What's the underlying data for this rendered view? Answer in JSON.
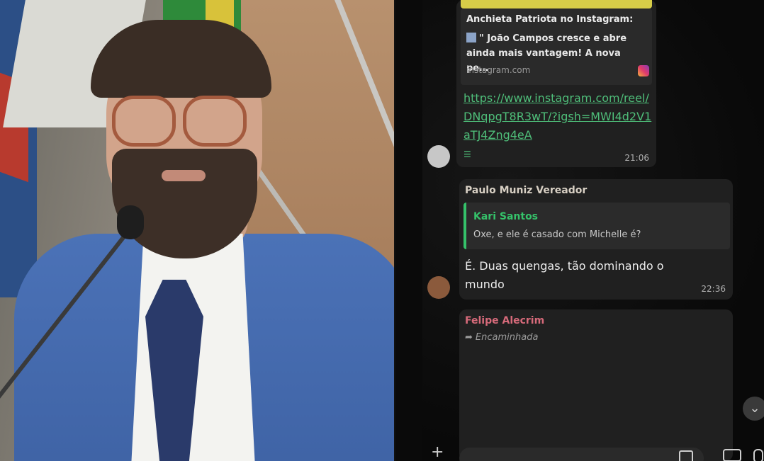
{
  "chat": {
    "message1": {
      "preview_title": "Anchieta Patriota no Instagram:",
      "preview_text": "\" João Campos cresce e abre ainda mais vantagem! A nova pe…",
      "preview_domain": "instagram.com",
      "link": "https://www.instagram.com/reel/DNqpgT8R3wT/?igsh=MWI4d2V1aTJ4Zng4eA",
      "time": "21:06"
    },
    "message2": {
      "sender": "Paulo Muniz Vereador",
      "quoted_name": "Kari Santos",
      "quoted_text": "Oxe, e ele é casado com Michelle é?",
      "text": "É. Duas quengas, tão dominando o mundo",
      "time": "22:36"
    },
    "message3": {
      "sender": "Felipe Alecrim",
      "forwarded_label": "Encaminhada"
    },
    "icons": {
      "forward": "forward-arrow-icon",
      "scroll_down": "chevron-down-icon",
      "attach": "plus-icon",
      "camera": "camera-icon",
      "mic": "microphone-icon",
      "sticker": "sticker-icon",
      "instagram": "instagram-icon"
    },
    "colors": {
      "link": "#4fbf7a",
      "quote_accent": "#35c26a",
      "sender3": "#d66a7a",
      "preview_bar": "#d7cd48"
    }
  }
}
